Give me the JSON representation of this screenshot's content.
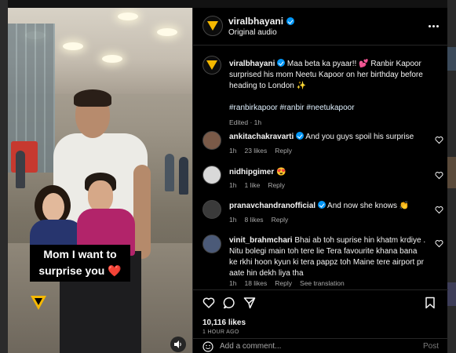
{
  "post": {
    "account": "viralbhayani",
    "audio": "Original audio",
    "caption_user": "viralbhayani",
    "caption_text": "Maa beta ka pyaar!! 💕 Ranbir Kapoor surprised his mom Neetu Kapoor on her birthday before heading to London ✨",
    "hashtags": "#ranbirkapoor #ranbir #neetukapoor",
    "edited": "Edited · 1h",
    "likes": "10,116 likes",
    "time_ago": "1 HOUR AGO"
  },
  "media": {
    "overlay_line1": "Mom I want to",
    "overlay_line2": "surprise you",
    "overlay_heart": "❤️"
  },
  "comments": [
    {
      "user": "ankitachakravarti",
      "verified": true,
      "text": "And you guys spoil his surprise",
      "time": "1h",
      "likes": "23 likes",
      "reply": "Reply"
    },
    {
      "user": "nidhipgimer",
      "verified": false,
      "text": "😍",
      "time": "1h",
      "likes": "1 like",
      "reply": "Reply"
    },
    {
      "user": "pranavchandranofficial",
      "verified": true,
      "text": "And now she knows 👏",
      "time": "1h",
      "likes": "8 likes",
      "reply": "Reply"
    },
    {
      "user": "vinit_brahmchari",
      "verified": false,
      "text": "Bhai ab toh suprise hin khatm krdiye . Nitu bolegi main toh tere lie Tera favourite khana bana ke rkhi hoon kyun ki tera pappz toh Maine tere airport pr aate hin dekh liya tha",
      "time": "1h",
      "likes": "18 likes",
      "reply": "Reply",
      "translate": "See translation"
    }
  ],
  "composer": {
    "placeholder": "Add a comment...",
    "post_label": "Post"
  },
  "colors": {
    "accent_blue": "#0095f6",
    "brand_yellow": "#f5b800",
    "background": "#000000",
    "muted_text": "#a8a8a8"
  }
}
